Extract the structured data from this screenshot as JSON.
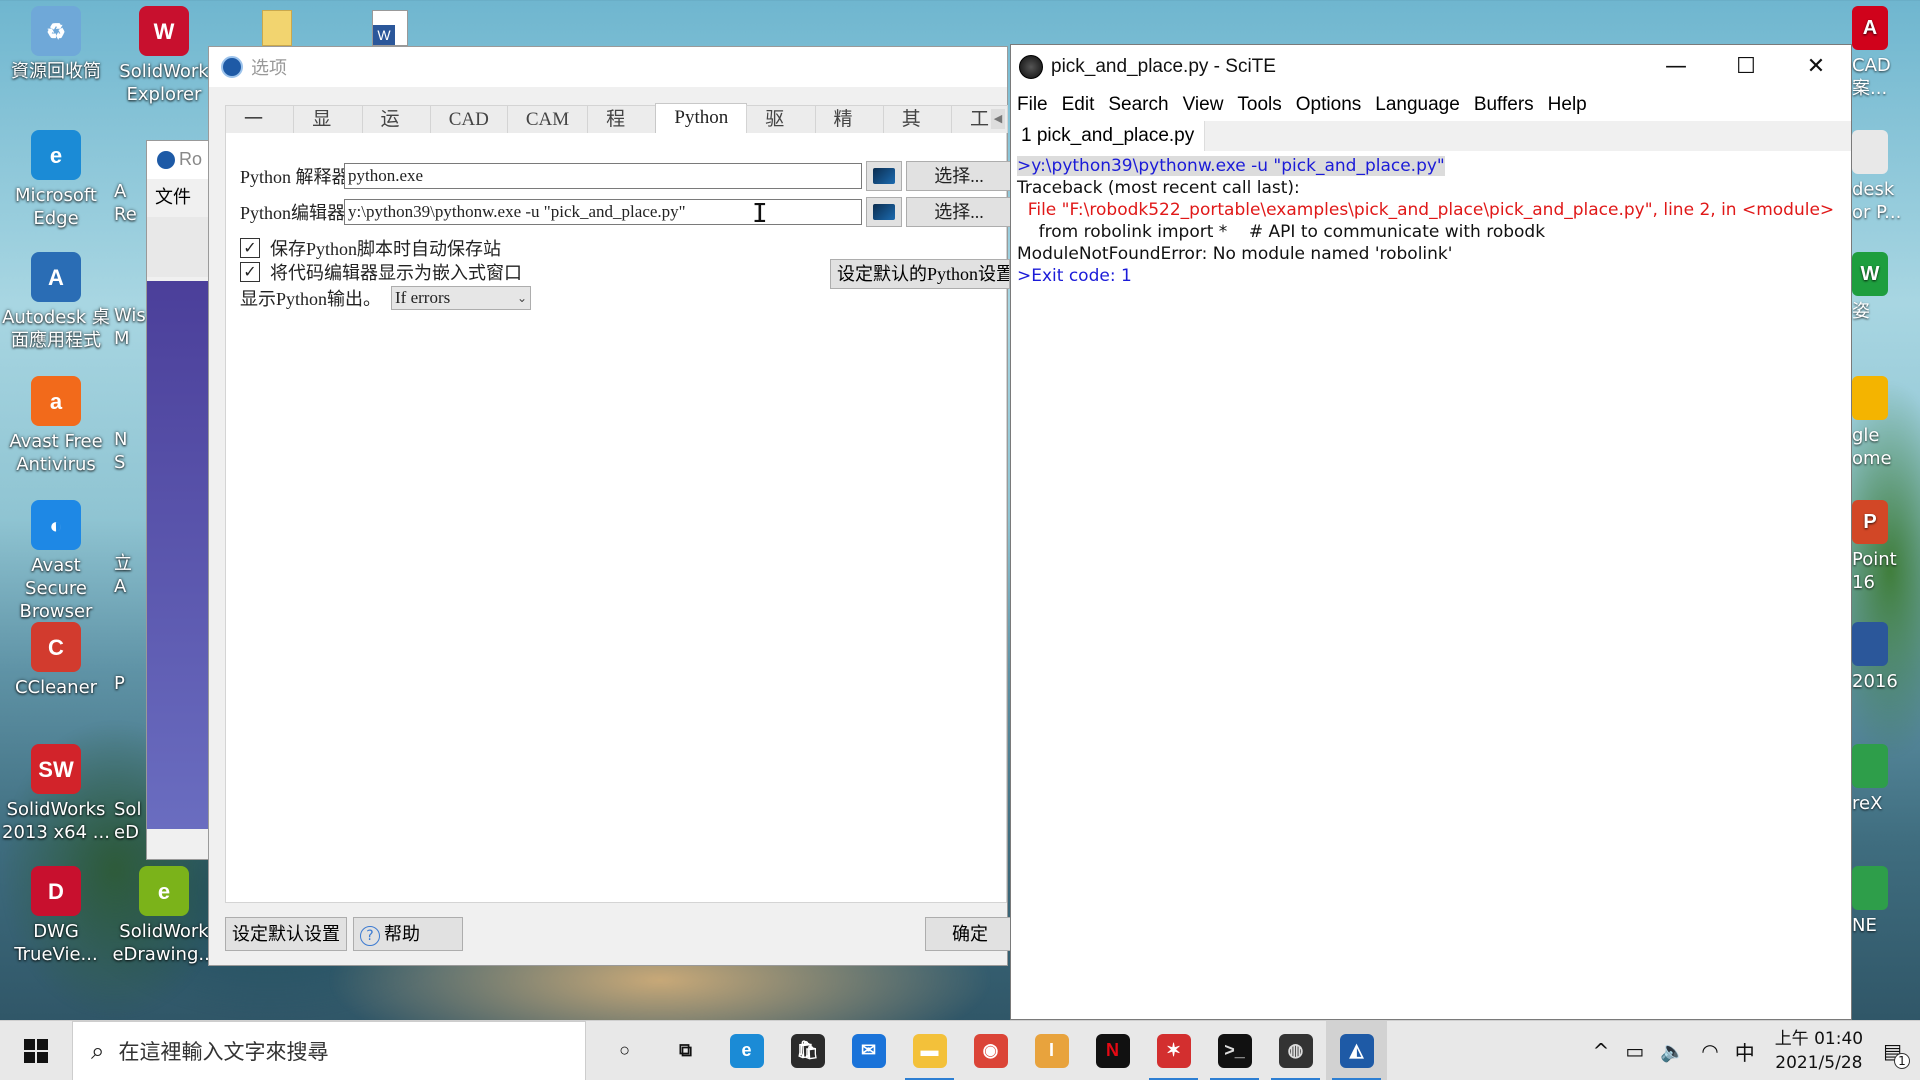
{
  "desktop": {
    "icons_left": [
      {
        "label": "資源回收筒",
        "glyph": "♻",
        "color": "#6fa8d8"
      },
      {
        "label": "Microsoft\nEdge",
        "glyph": "e",
        "color": "#1b8bd6"
      },
      {
        "label": "Autodesk 桌\n面應用程式",
        "glyph": "A",
        "color": "#2a6db5"
      },
      {
        "label": "Avast Free\nAntivirus",
        "glyph": "a",
        "color": "#f26a1b"
      },
      {
        "label": "Avast Secure\nBrowser",
        "glyph": "◐",
        "color": "#1e88e5"
      },
      {
        "label": "CCleaner",
        "glyph": "C",
        "color": "#d23b2e"
      },
      {
        "label": "SolidWorks\n2013 x64 ...",
        "glyph": "SW",
        "color": "#d2232a"
      },
      {
        "label": "DWG\nTrueVie...",
        "glyph": "D",
        "color": "#c8102e"
      }
    ],
    "icons_col2": [
      {
        "label": "SolidWork\nExplorer",
        "glyph": "W",
        "color": "#c8102e"
      },
      {
        "label": "SolidWork\neDrawing...",
        "glyph": "e",
        "color": "#7bb31a"
      }
    ],
    "partial_col2": [
      "A\nRe",
      "Wis\nM",
      "N\nS",
      "立\nA",
      "P",
      "Sol\neD"
    ],
    "top_docs": [
      {
        "glyph": "",
        "color": "#f2d46f"
      },
      {
        "glyph": "W",
        "color": "#2b579a"
      }
    ],
    "right_partial": [
      {
        "label": "CAD\n案...",
        "glyph": "A",
        "color": "#d0021b"
      },
      {
        "label": "desk\nor P...",
        "glyph": "",
        "color": "#e8e8e8"
      },
      {
        "label": "姿",
        "glyph": "W",
        "color": "#1e9e3e"
      },
      {
        "label": "gle\nome",
        "glyph": "",
        "color": "#f4b400"
      },
      {
        "label": "Point\n16",
        "glyph": "P",
        "color": "#d24726"
      },
      {
        "label": "2016",
        "glyph": "",
        "color": "#2b579a"
      },
      {
        "label": "reX",
        "glyph": "",
        "color": "#2e9e4a"
      },
      {
        "label": "NE",
        "glyph": "",
        "color": "#2e9e4a"
      }
    ]
  },
  "robodk_bg": {
    "title": "Ro",
    "menu": "文件"
  },
  "options_dialog": {
    "title": "选项",
    "tabs": [
      "一般",
      "显示",
      "运动",
      "CAD",
      "CAM",
      "程序",
      "Python",
      "驱动",
      "精度",
      "其他",
      "工"
    ],
    "active_tab": "Python",
    "interpreter_label": "Python 解释器",
    "interpreter_value": "python.exe",
    "editor_label": "Python编辑器",
    "editor_value": "y:\\python39\\pythonw.exe -u \"pick_and_place.py\"",
    "choose_label": "选择...",
    "check1": {
      "label": "保存Python脚本时自动保存站",
      "checked": "✓"
    },
    "check2": {
      "label": "将代码编辑器显示为嵌入式窗口",
      "checked": "✓"
    },
    "show_output_label": "显示Python输出。",
    "show_output_value": "If errors",
    "default_python_btn": "设定默认的Python设置",
    "reset_btn": "设定默认设置",
    "help_btn": "帮助",
    "help_glyph": "?",
    "ok_btn": "确定"
  },
  "scite": {
    "title": "pick_and_place.py - SciTE",
    "menu": [
      "File",
      "Edit",
      "Search",
      "View",
      "Tools",
      "Options",
      "Language",
      "Buffers",
      "Help"
    ],
    "tab": "1 pick_and_place.py",
    "controls": {
      "minimize": "—",
      "maximize": "☐",
      "close": "✕"
    },
    "output": [
      {
        "text": ">y:\\python39\\pythonw.exe -u \"pick_and_place.py\"",
        "style": "cmd"
      },
      {
        "text": "Traceback (most recent call last):",
        "style": "black"
      },
      {
        "text": "  File \"F:\\robodk522_portable\\examples\\pick_and_place\\pick_and_place.py\", line 2, in <module>",
        "style": "red"
      },
      {
        "text": "    from robolink import *    # API to communicate with robodk",
        "style": "black"
      },
      {
        "text": "ModuleNotFoundError: No module named 'robolink'",
        "style": "black"
      },
      {
        "text": ">Exit code: 1",
        "style": "blue"
      }
    ]
  },
  "taskbar": {
    "search_placeholder": "在這裡輸入文字來搜尋",
    "apps": [
      {
        "name": "cortana",
        "glyph": "○",
        "color": "transparent",
        "fg": "#111"
      },
      {
        "name": "task-view",
        "glyph": "⧉",
        "color": "transparent",
        "fg": "#111"
      },
      {
        "name": "edge",
        "glyph": "e",
        "color": "#1b8bd6",
        "fg": "#fff"
      },
      {
        "name": "store",
        "glyph": "🛍",
        "color": "#2b2b2b",
        "fg": "#fff"
      },
      {
        "name": "mail",
        "glyph": "✉",
        "color": "#1a73d9",
        "fg": "#fff"
      },
      {
        "name": "explorer",
        "glyph": "▬",
        "color": "#f3c13a",
        "fg": "#fff"
      },
      {
        "name": "chrome",
        "glyph": "◉",
        "color": "#db4437",
        "fg": "#fff"
      },
      {
        "name": "inventor",
        "glyph": "I",
        "color": "#e8a33d",
        "fg": "#fff"
      },
      {
        "name": "netflix",
        "glyph": "N",
        "color": "#111",
        "fg": "#e50914"
      },
      {
        "name": "dance",
        "glyph": "✶",
        "color": "#d32f2f",
        "fg": "#fff"
      },
      {
        "name": "terminal",
        "glyph": ">_",
        "color": "#111",
        "fg": "#ddd"
      },
      {
        "name": "scite",
        "glyph": "◍",
        "color": "#333",
        "fg": "#ddd"
      },
      {
        "name": "robodk",
        "glyph": "◭",
        "color": "#1e5aa6",
        "fg": "#fff"
      }
    ],
    "tray": {
      "chevron": "^",
      "battery": "▭",
      "volume": "🔈",
      "wifi": "◠",
      "ime": "中",
      "notif": "▤"
    },
    "time": "上午 01:40",
    "date": "2021/5/28",
    "notif_count": "1"
  }
}
